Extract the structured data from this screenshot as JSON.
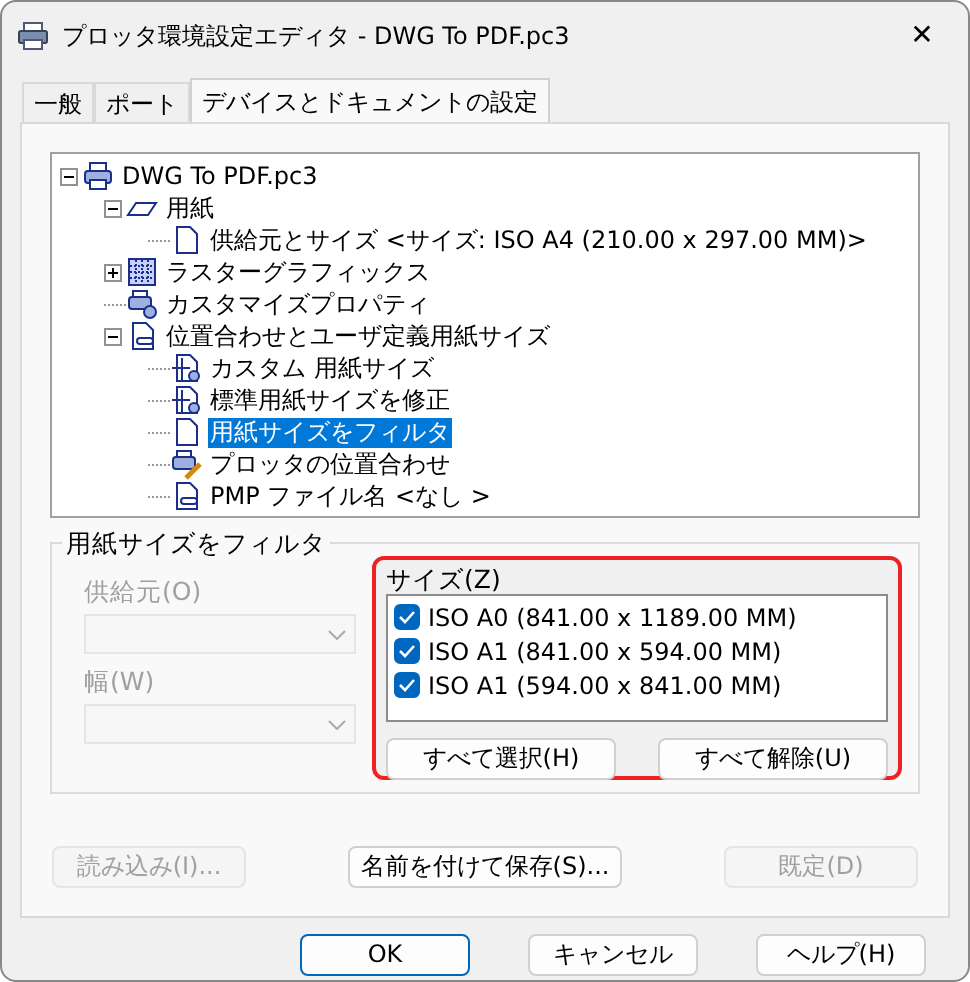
{
  "window": {
    "title": "プロッタ環境設定エディタ - DWG To PDF.pc3",
    "close": "✕"
  },
  "tabs": [
    {
      "label": "一般",
      "selected": false
    },
    {
      "label": "ポート",
      "selected": false
    },
    {
      "label": "デバイスとドキュメントの設定",
      "selected": true
    }
  ],
  "tree": [
    {
      "label": "DWG To PDF.pc3",
      "kind": "printer",
      "expanded": true,
      "selected": false,
      "children": [
        {
          "label": "用紙",
          "kind": "paper",
          "expanded": true,
          "selected": false,
          "children": [
            {
              "label": "供給元とサイズ <サイズ: ISO A4 (210.00 x 297.00 MM)>",
              "kind": "document",
              "selected": false
            }
          ]
        },
        {
          "label": "ラスターグラフィックス",
          "kind": "raster",
          "expanded": false,
          "selected": false
        },
        {
          "label": "カスタマイズプロパティ",
          "kind": "printer-props",
          "selected": false
        },
        {
          "label": "位置合わせとユーザ定義用紙サイズ",
          "kind": "layout",
          "expanded": true,
          "selected": false,
          "children": [
            {
              "label": "カスタム 用紙サイズ",
              "kind": "custom-size",
              "selected": false
            },
            {
              "label": "標準用紙サイズを修正",
              "kind": "custom-size",
              "selected": false
            },
            {
              "label": "用紙サイズをフィルタ",
              "kind": "document",
              "selected": true
            },
            {
              "label": "プロッタの位置合わせ",
              "kind": "calibrate",
              "selected": false
            },
            {
              "label": "PMP ファイル名 <なし >",
              "kind": "layout",
              "selected": false
            }
          ]
        }
      ]
    }
  ],
  "filter_group": {
    "title": "用紙サイズをフィルタ",
    "fields": [
      {
        "label": "供給元(O)",
        "disabled": true
      },
      {
        "label": "幅(W)",
        "disabled": true
      }
    ],
    "size_list": {
      "label": "サイズ(Z)",
      "highlighted": true,
      "items": [
        {
          "label": "ISO A0 (841.00 x 1189.00 MM)",
          "checked": true
        },
        {
          "label": "ISO A1 (841.00 x 594.00 MM)",
          "checked": true
        },
        {
          "label": "ISO A1 (594.00 x 841.00 MM)",
          "checked": true
        }
      ],
      "buttons": [
        {
          "label": "すべて選択(H)"
        },
        {
          "label": "すべて解除(U)"
        }
      ]
    }
  },
  "action_buttons": [
    {
      "label": "読み込み(I)...",
      "disabled": true
    },
    {
      "label": "名前を付けて保存(S)...",
      "disabled": false
    },
    {
      "label": "既定(D)",
      "disabled": true
    }
  ],
  "dialog_buttons": [
    {
      "label": "OK",
      "default": true
    },
    {
      "label": "キャンセル",
      "default": false
    },
    {
      "label": "ヘルプ(H)",
      "default": false
    }
  ]
}
